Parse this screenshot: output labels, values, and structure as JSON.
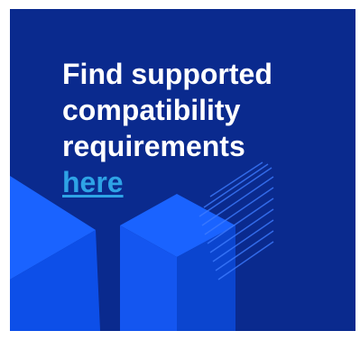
{
  "banner": {
    "line1": "Find supported",
    "line2": "compatibility",
    "line3": "requirements",
    "link_label": "here"
  },
  "colors": {
    "background": "#0a2a8e",
    "cube_light": "#1a63ff",
    "cube_dark": "#0b47d6",
    "link": "#2ea3e6",
    "text": "#ffffff"
  }
}
